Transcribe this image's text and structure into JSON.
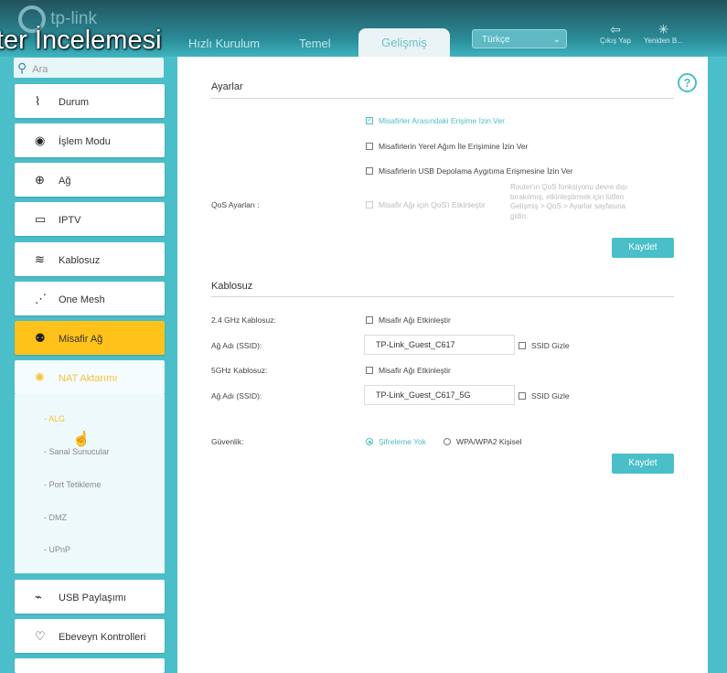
{
  "header": {
    "logo_text": "tp-link",
    "video_title": "ter İncelemesi",
    "nav": [
      "Hızlı Kurulum",
      "Temel",
      "Gelişmiş"
    ],
    "language": "Türkçe",
    "logout_label": "Çıkış Yap",
    "reboot_label": "Yeniden B..."
  },
  "sidebar": {
    "search_placeholder": "Ara",
    "items": [
      {
        "label": "Durum",
        "icon": "pulse-icon"
      },
      {
        "label": "İşlem Modu",
        "icon": "toggle-icon"
      },
      {
        "label": "Ağ",
        "icon": "globe-icon"
      },
      {
        "label": "IPTV",
        "icon": "monitor-icon"
      },
      {
        "label": "Kablosuz",
        "icon": "wifi-icon"
      },
      {
        "label": "One Mesh",
        "icon": "mesh-icon"
      },
      {
        "label": "Misafir Ağ",
        "icon": "guests-icon"
      },
      {
        "label": "NAT Aktarımı",
        "icon": "nat-icon"
      },
      {
        "label": "USB Paylaşımı",
        "icon": "usb-icon"
      },
      {
        "label": "Ebeveyn Kontrolleri",
        "icon": "heart-icon"
      }
    ],
    "nat_sub": [
      "- ALG",
      "- Sanal Sunucular",
      "- Port Tetikleme",
      "- DMZ",
      "- UPnP"
    ]
  },
  "settings": {
    "title": "Ayarlar",
    "allow_inter_guest": "Misafirler Arasındaki Erişime İzin Ver",
    "allow_local": "Misafirlerin Yerel Ağım İle Erişimine İzin Ver",
    "allow_usb": "Misafirlerin USB Depolama Aygıtıma Erişmesine İzin Ver",
    "qos_label": "QoS Ayarları :",
    "qos_checkbox": "Misafir Ağı için QoS'i Etkinleştir",
    "qos_note": "Router'ın QoS fonksiyonu devre dışı bırakılmış, etkinleştirmek için lütfen Gelişmiş > QoS > Ayarlar sayfasına gidin.",
    "save": "Kaydet"
  },
  "wireless": {
    "title": "Kablosuz",
    "band24_label": "2.4 GHz Kablosuz:",
    "band24_enable": "Misafir Ağı Etkinleştir",
    "ssid_label": "Ağ Adı (SSID):",
    "ssid24_value": "TP-Link_Guest_C617",
    "hide_ssid": "SSID Gizle",
    "band5_label": "5GHz Kablosuz:",
    "band5_enable": "Misafir Ağı Etkinleştir",
    "ssid5_value": "TP-Link_Guest_C617_5G",
    "security_label": "Güvenlik:",
    "sec_none": "Şifreleme Yok",
    "sec_wpa": "WPA/WPA2 Kişisel",
    "save": "Kaydet"
  },
  "colors": {
    "accent": "#4bbfc9",
    "active_item": "#ffc21a"
  }
}
